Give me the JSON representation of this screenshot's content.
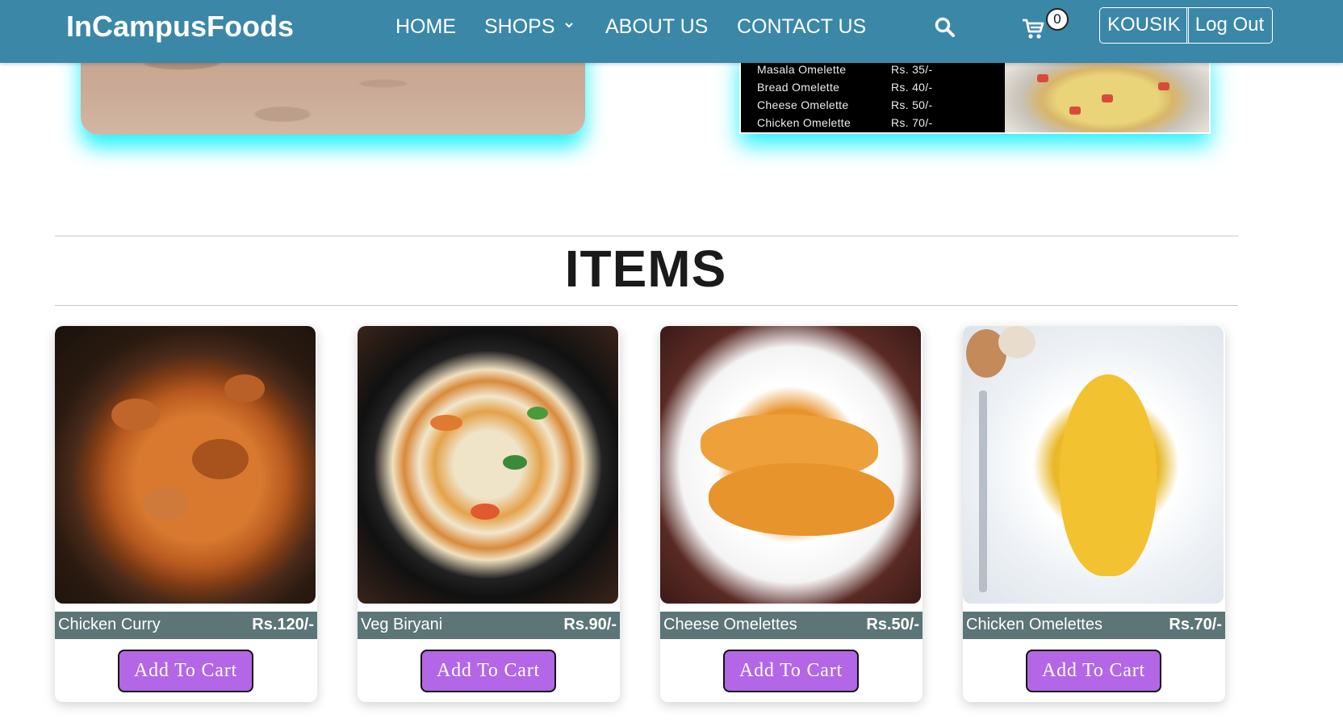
{
  "navbar": {
    "brand": "InCampusFoods",
    "links": {
      "home": "HOME",
      "shops": "SHOPS",
      "about": "ABOUT US",
      "contact": "CONTACT US"
    },
    "cart_count": "0",
    "user_label": "KOUSIK",
    "logout_label": "Log Out"
  },
  "banner_menu": [
    {
      "name": "Masala Omelette",
      "price": "Rs. 35/-"
    },
    {
      "name": "Bread Omelette",
      "price": "Rs. 40/-"
    },
    {
      "name": "Cheese Omelette",
      "price": "Rs. 50/-"
    },
    {
      "name": "Chicken Omelette",
      "price": "Rs. 70/-"
    }
  ],
  "section": {
    "title": "ITEMS"
  },
  "items": [
    {
      "name": "Chicken Curry",
      "price": "Rs.120/-",
      "button": "Add To Cart"
    },
    {
      "name": "Veg Biryani",
      "price": "Rs.90/-",
      "button": "Add To Cart"
    },
    {
      "name": "Cheese Omelettes",
      "price": "Rs.50/-",
      "button": "Add To Cart"
    },
    {
      "name": "Chicken Omelettes",
      "price": "Rs.70/-",
      "button": "Add To Cart"
    }
  ],
  "colors": {
    "navbar": "#3b87a8",
    "item_bar": "#5c7576",
    "button": "#b366e6",
    "glow": "#00f0ff"
  }
}
